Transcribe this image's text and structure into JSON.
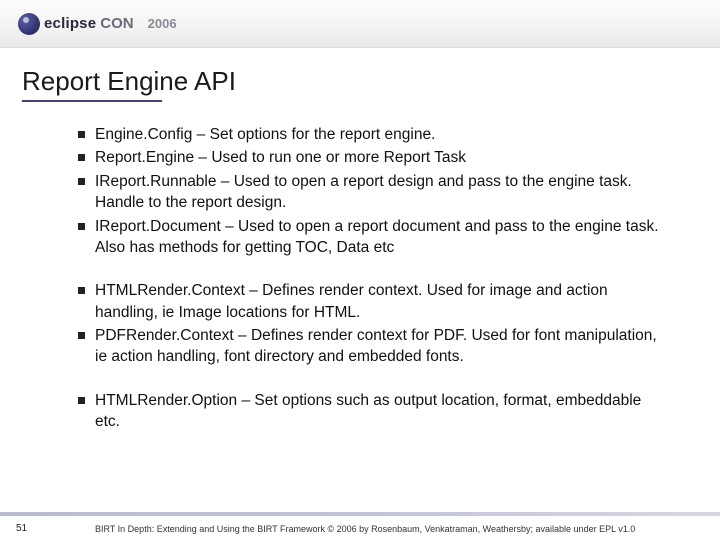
{
  "brand": {
    "part1": "eclipse",
    "part2": "CON",
    "year": "2006"
  },
  "title": "Report Engine API",
  "groups": [
    {
      "bullets": [
        "Engine.Config – Set options for the report engine.",
        "Report.Engine – Used to run one or more Report Task",
        "IReport.Runnable – Used to open a report design and pass to the engine task.  Handle to the report design.",
        "IReport.Document – Used to open a report document and pass to the engine task.  Also has methods for getting TOC, Data etc"
      ]
    },
    {
      "bullets": [
        "HTMLRender.Context – Defines render context.  Used for image and action handling, ie Image locations for HTML.",
        "PDFRender.Context – Defines render context for PDF.  Used for font manipulation, ie action handling, font directory and embedded fonts."
      ]
    },
    {
      "bullets": [
        "HTMLRender.Option – Set options such as output location, format, embeddable etc."
      ]
    }
  ],
  "page_number": "51",
  "footer": "BIRT In Depth: Extending and Using the BIRT Framework © 2006 by Rosenbaum, Venkatraman, Weathersby; available under EPL v1.0"
}
